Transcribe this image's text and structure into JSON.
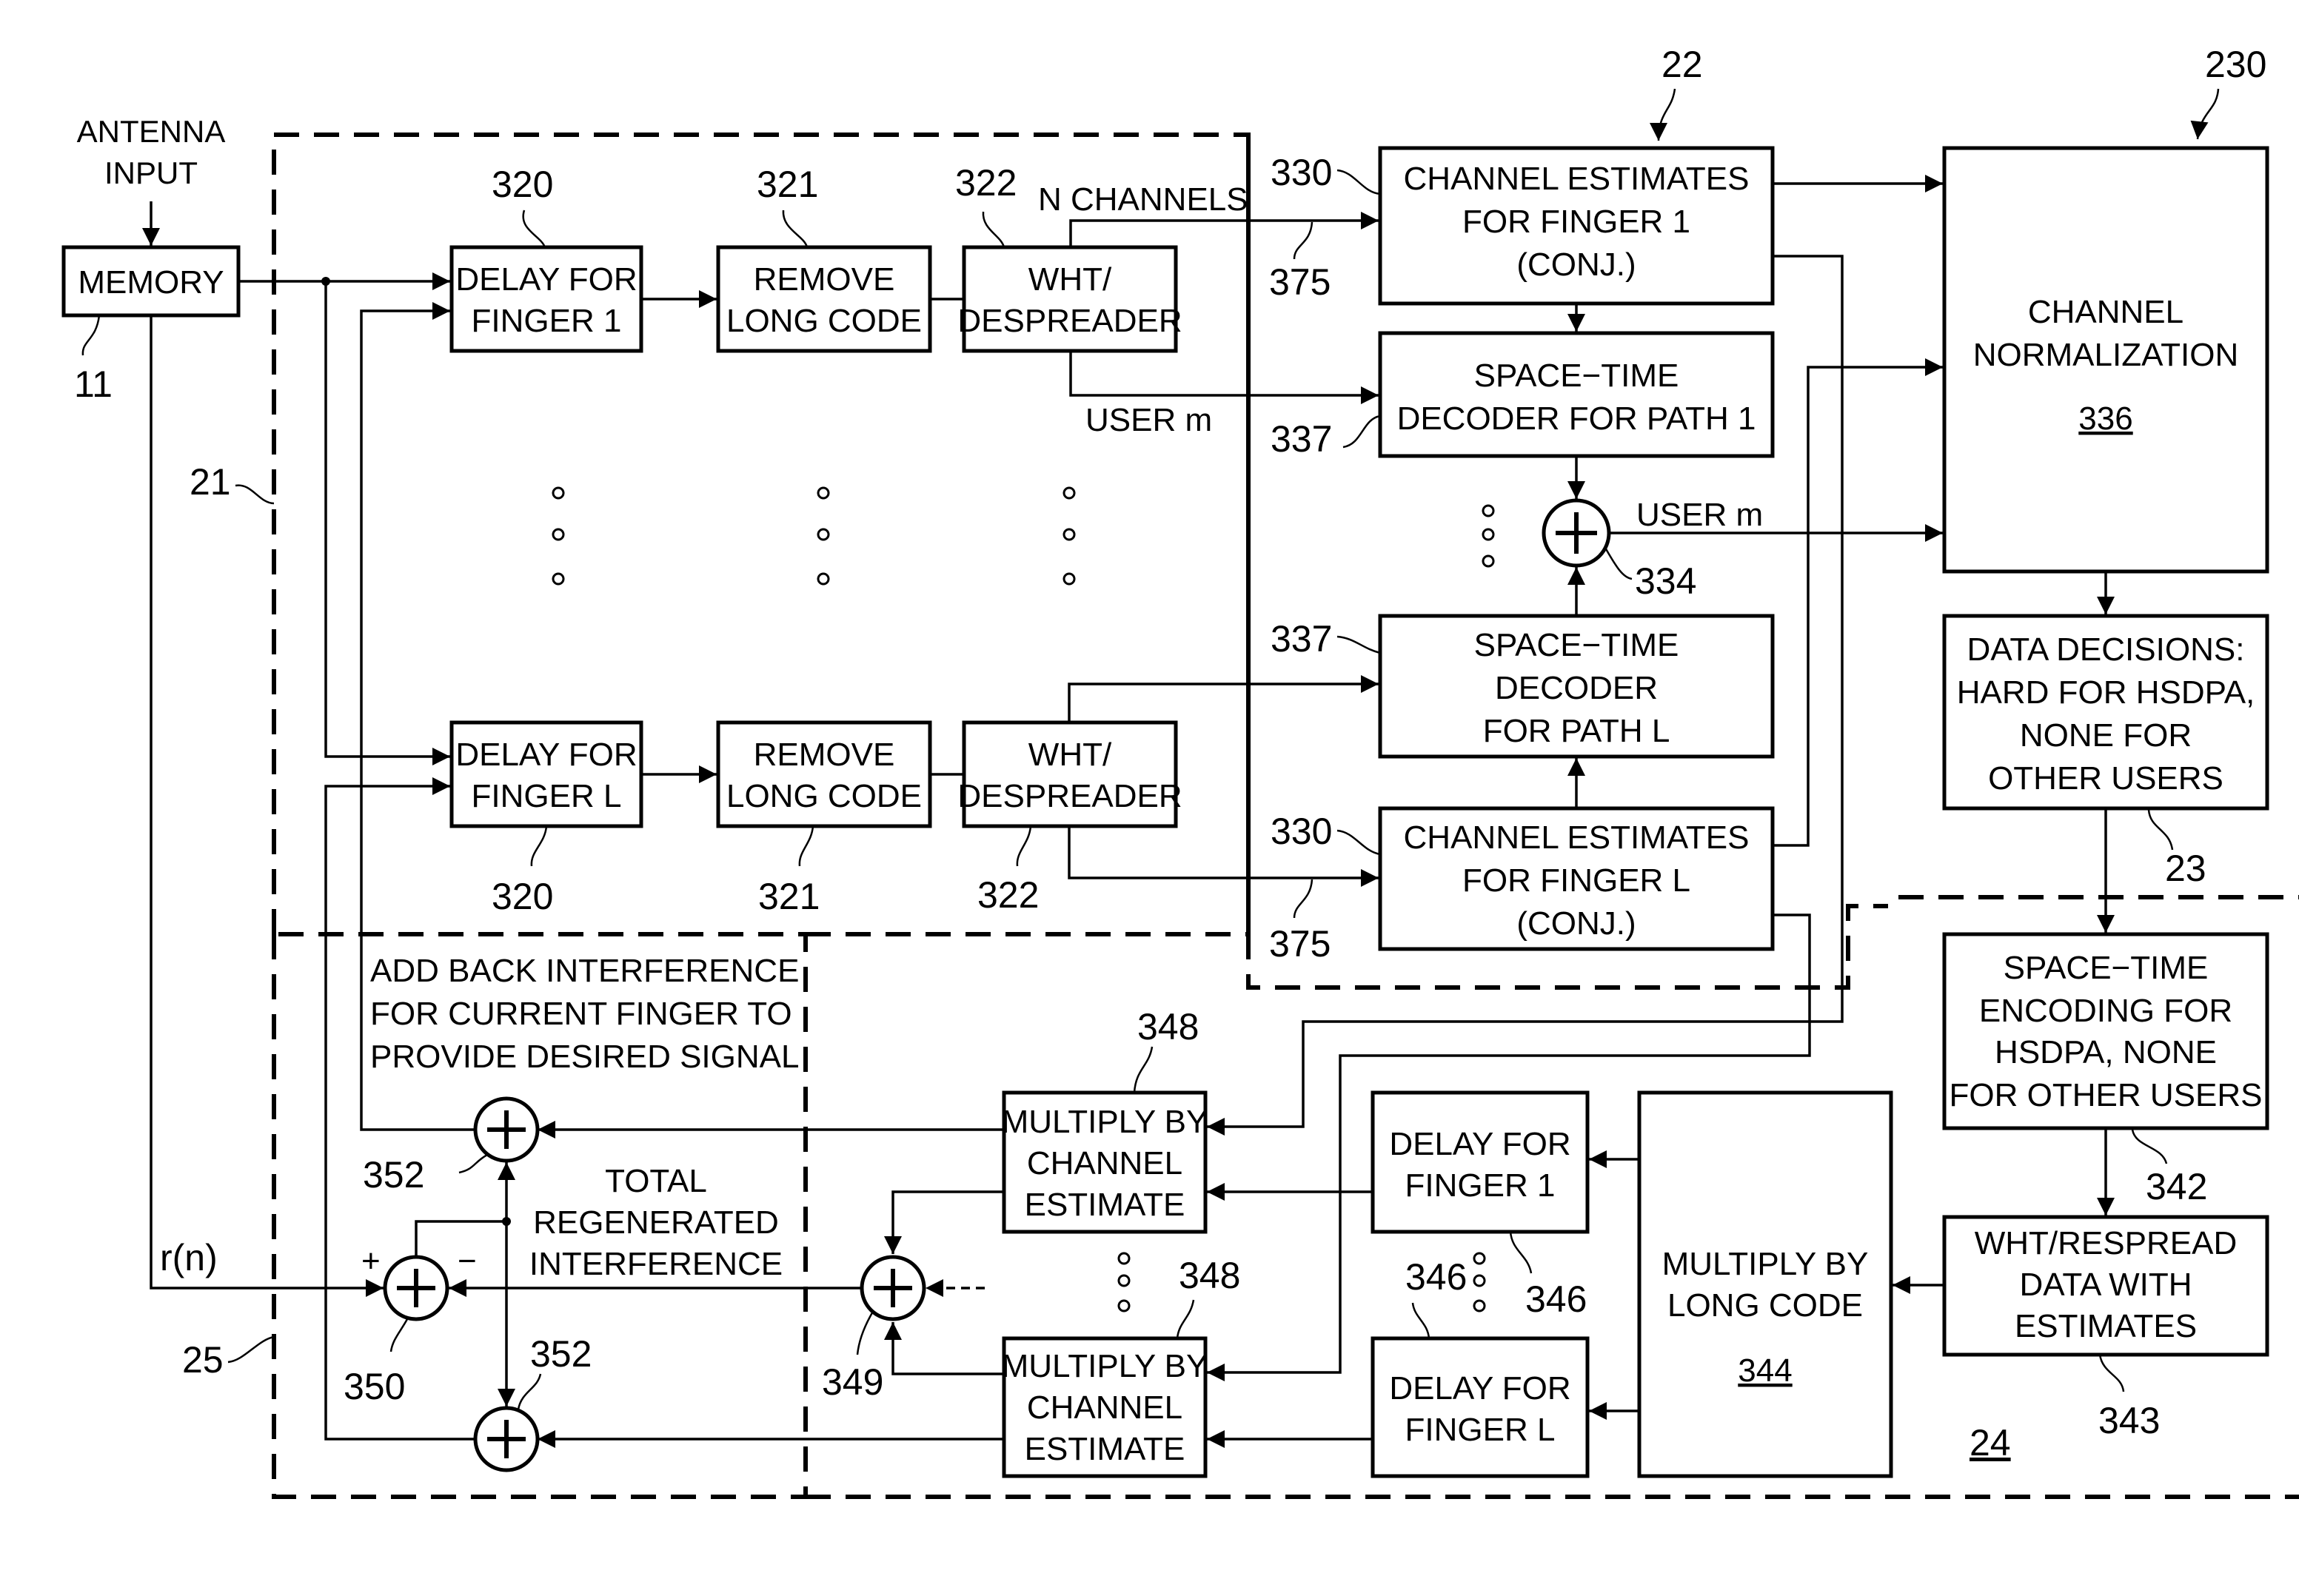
{
  "antenna_input": [
    "ANTENNA",
    "INPUT"
  ],
  "memory": {
    "label": "MEMORY",
    "ref": "11"
  },
  "module_refs": {
    "despread": "21",
    "channel_est": "22",
    "normalization": "230",
    "decisions": "23",
    "regeneration": "24",
    "cancellation": "25"
  },
  "finger_1": {
    "delay": {
      "lines": [
        "DELAY FOR",
        "FINGER 1"
      ],
      "ref": "320"
    },
    "remove": {
      "lines": [
        "REMOVE",
        "LONG CODE"
      ],
      "ref": "321"
    },
    "wht": {
      "lines": [
        "WHT/",
        "DESPREADER"
      ],
      "ref": "322"
    }
  },
  "finger_l": {
    "delay": {
      "lines": [
        "DELAY FOR",
        "FINGER L"
      ],
      "ref": "320"
    },
    "remove": {
      "lines": [
        "REMOVE",
        "LONG CODE"
      ],
      "ref": "321"
    },
    "wht": {
      "lines": [
        "WHT/",
        "DESPREADER"
      ],
      "ref": "322"
    }
  },
  "signal_labels": {
    "n_channels": "N CHANNELS",
    "user_m_1": "USER m",
    "user_m_2": "USER m",
    "r_n": "r(n)",
    "plus_sign": "+",
    "minus_sign": "−",
    "line_ref_1": "375",
    "line_ref_2": "375"
  },
  "ce_finger_1": {
    "lines": [
      "CHANNEL ESTIMATES",
      "FOR FINGER 1",
      "(CONJ.)"
    ],
    "ref": "330"
  },
  "st_decoder_1": {
    "lines": [
      "SPACE−TIME",
      "DECODER FOR PATH 1"
    ],
    "ref": "337"
  },
  "combiner": {
    "ref": "334"
  },
  "st_decoder_l": {
    "lines": [
      "SPACE−TIME",
      "DECODER",
      "FOR PATH L"
    ],
    "ref": "337"
  },
  "ce_finger_l": {
    "lines": [
      "CHANNEL ESTIMATES",
      "FOR FINGER L",
      "(CONJ.)"
    ],
    "ref": "330"
  },
  "channel_normalization": {
    "lines": [
      "CHANNEL",
      "NORMALIZATION"
    ],
    "ref": "336"
  },
  "data_decisions": {
    "lines": [
      "DATA DECISIONS:",
      "HARD FOR HSDPA,",
      "NONE FOR",
      "OTHER USERS"
    ]
  },
  "st_encoding": {
    "lines": [
      "SPACE−TIME",
      "ENCODING FOR",
      "HSDPA, NONE",
      "FOR OTHER USERS"
    ],
    "ref": "342"
  },
  "wht_respread": {
    "lines": [
      "WHT/RESPREAD",
      "DATA WITH",
      "ESTIMATES"
    ],
    "ref": "343"
  },
  "mult_long_code": {
    "lines": [
      "MULTIPLY BY",
      "LONG CODE"
    ],
    "ref": "344"
  },
  "regen_delay_1": {
    "lines": [
      "DELAY FOR",
      "FINGER 1"
    ],
    "ref": "346"
  },
  "regen_delay_l": {
    "lines": [
      "DELAY FOR",
      "FINGER L"
    ],
    "ref": "346"
  },
  "mult_ch_est_1": {
    "lines": [
      "MULTIPLY BY",
      "CHANNEL",
      "ESTIMATE"
    ],
    "ref": "348"
  },
  "mult_ch_est_l": {
    "lines": [
      "MULTIPLY BY",
      "CHANNEL",
      "ESTIMATE"
    ],
    "ref": "348"
  },
  "sum_regen": {
    "ref": "349"
  },
  "sum_subtract": {
    "ref": "350"
  },
  "sum_add_back_1": {
    "ref": "352"
  },
  "sum_add_back_l": {
    "ref": "352"
  },
  "add_back_note": [
    "ADD BACK INTERFERENCE",
    "FOR CURRENT FINGER TO",
    "PROVIDE DESIRED SIGNAL"
  ],
  "total_interference_note": [
    "TOTAL",
    "REGENERATED",
    "INTERFERENCE"
  ]
}
